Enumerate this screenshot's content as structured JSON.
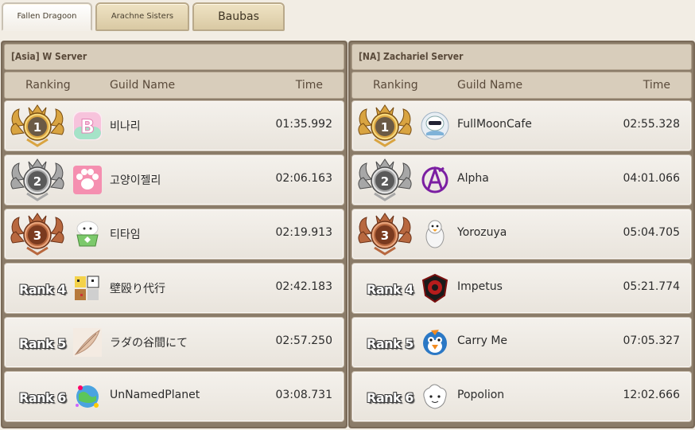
{
  "tabs": [
    {
      "label": "Fallen Dragoon",
      "active": true
    },
    {
      "label": "Arachne Sisters",
      "active": false
    },
    {
      "label": "Baubas",
      "active": false
    }
  ],
  "columns": {
    "ranking": "Ranking",
    "guild": "Guild Name",
    "time": "Time"
  },
  "colors": {
    "gold": "#d9a441",
    "silver": "#a7a7a7",
    "bronze": "#b8683f"
  },
  "servers": [
    {
      "title": "[Asia] W Server",
      "rows": [
        {
          "medal": "1",
          "rank_label": "",
          "guild": "비나리",
          "time": "01:35.992",
          "emblem": "letter-b-emblem-icon"
        },
        {
          "medal": "2",
          "rank_label": "",
          "guild": "고양이젤리",
          "time": "02:06.163",
          "emblem": "paw-emblem-icon"
        },
        {
          "medal": "3",
          "rank_label": "",
          "guild": "티타임",
          "time": "02:19.913",
          "emblem": "teacup-sheep-emblem-icon"
        },
        {
          "medal": "",
          "rank_label": "Rank 4",
          "guild": "壁殴り代行",
          "time": "02:42.183",
          "emblem": "pixel-characters-emblem-icon"
        },
        {
          "medal": "",
          "rank_label": "Rank 5",
          "guild": "ラダの谷間にて",
          "time": "02:57.250",
          "emblem": "feather-emblem-icon"
        },
        {
          "medal": "",
          "rank_label": "Rank 6",
          "guild": "UnNamedPlanet",
          "time": "03:08.731",
          "emblem": "planet-emblem-icon"
        }
      ]
    },
    {
      "title": "[NA] Zachariel Server",
      "rows": [
        {
          "medal": "1",
          "rank_label": "",
          "guild": "FullMoonCafe",
          "time": "02:55.328",
          "emblem": "moon-creature-emblem-icon"
        },
        {
          "medal": "2",
          "rank_label": "",
          "guild": "Alpha",
          "time": "04:01.066",
          "emblem": "alpha-symbol-emblem-icon"
        },
        {
          "medal": "3",
          "rank_label": "",
          "guild": "Yorozuya",
          "time": "05:04.705",
          "emblem": "penguin-emblem-icon"
        },
        {
          "medal": "",
          "rank_label": "Rank 4",
          "guild": "Impetus",
          "time": "05:21.774",
          "emblem": "red-crest-emblem-icon"
        },
        {
          "medal": "",
          "rank_label": "Rank 5",
          "guild": "Carry Me",
          "time": "07:05.327",
          "emblem": "blue-bird-emblem-icon"
        },
        {
          "medal": "",
          "rank_label": "Rank 6",
          "guild": "Popolion",
          "time": "12:02.666",
          "emblem": "popolion-emblem-icon"
        }
      ]
    }
  ]
}
